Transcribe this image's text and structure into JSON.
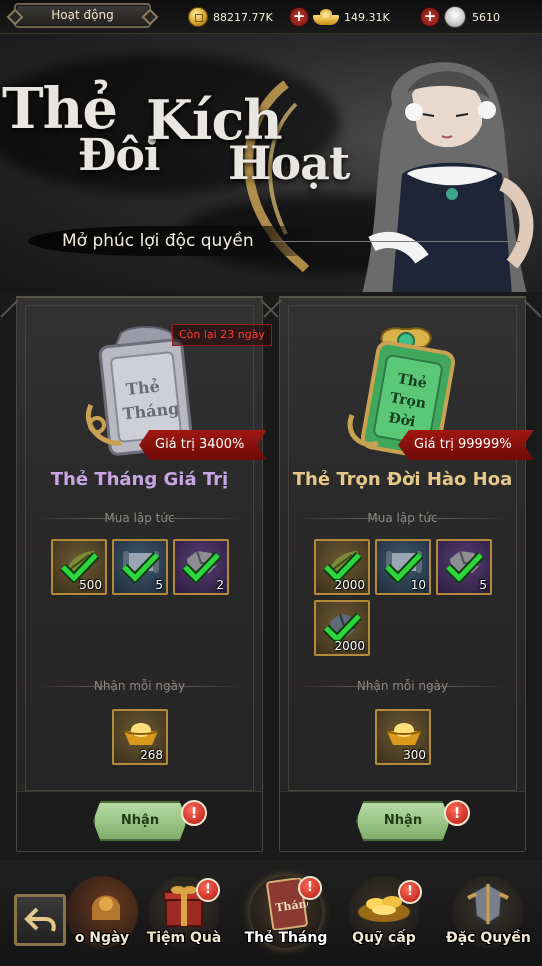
{
  "topbar": {
    "activity_label": "Hoạt động",
    "coins": "88217.77K",
    "ingots": "149.31K",
    "buns": "5610"
  },
  "banner": {
    "title_words": [
      "Thẻ",
      "Đôi",
      "Kích",
      "Hoạt"
    ],
    "subtitle": "Mở phúc lợi độc quyền"
  },
  "cards": [
    {
      "art_label": [
        "Thẻ",
        "Tháng"
      ],
      "badge": "Còn lại 23 ngày",
      "value": "Giá trị 3400%",
      "name": "Thẻ Tháng Giá Trị",
      "name_color": "#c8a6e6",
      "buy_label": "Mua lập tức",
      "buy_items": [
        {
          "icon": "herb-icon",
          "qty": "500"
        },
        {
          "icon": "scroll-icon",
          "qty": "5"
        },
        {
          "icon": "ore-icon",
          "qty": "2"
        }
      ],
      "daily_label": "Nhận mỗi ngày",
      "daily_items": [
        {
          "icon": "gold-ingot-icon",
          "qty": "268"
        }
      ],
      "claim_label": "Nhận"
    },
    {
      "art_label": [
        "Thẻ",
        "Trọn",
        "Đời"
      ],
      "value": "Giá trị 99999%",
      "name": "Thẻ Trọn Đời Hào Hoa",
      "name_color": "#e6c98a",
      "buy_label": "Mua lập tức",
      "buy_items": [
        {
          "icon": "herb-icon",
          "qty": "2000"
        },
        {
          "icon": "scroll-icon",
          "qty": "10"
        },
        {
          "icon": "ore-icon",
          "qty": "5"
        },
        {
          "icon": "stone-icon",
          "qty": "2000"
        }
      ],
      "daily_label": "Nhận mỗi ngày",
      "daily_items": [
        {
          "icon": "gold-ingot-icon",
          "qty": "300"
        }
      ],
      "claim_label": "Nhận"
    }
  ],
  "nav": [
    {
      "label": "o Ngày",
      "icon": "calendar-icon"
    },
    {
      "label": "Tiệm Quà",
      "icon": "gift-box-icon"
    },
    {
      "label": "Thẻ Tháng",
      "icon": "card-icon",
      "art_text": "Tháng"
    },
    {
      "label": "Quỹ cấp",
      "icon": "treasure-icon"
    },
    {
      "label": "Đặc Quyền",
      "icon": "armor-icon"
    }
  ],
  "alert_glyph": "!",
  "colors": {
    "accent_gold": "#b48a3d",
    "claim_green": "#9cc98a",
    "ribbon_red": "#a11812",
    "alert_red": "#c9261a"
  }
}
